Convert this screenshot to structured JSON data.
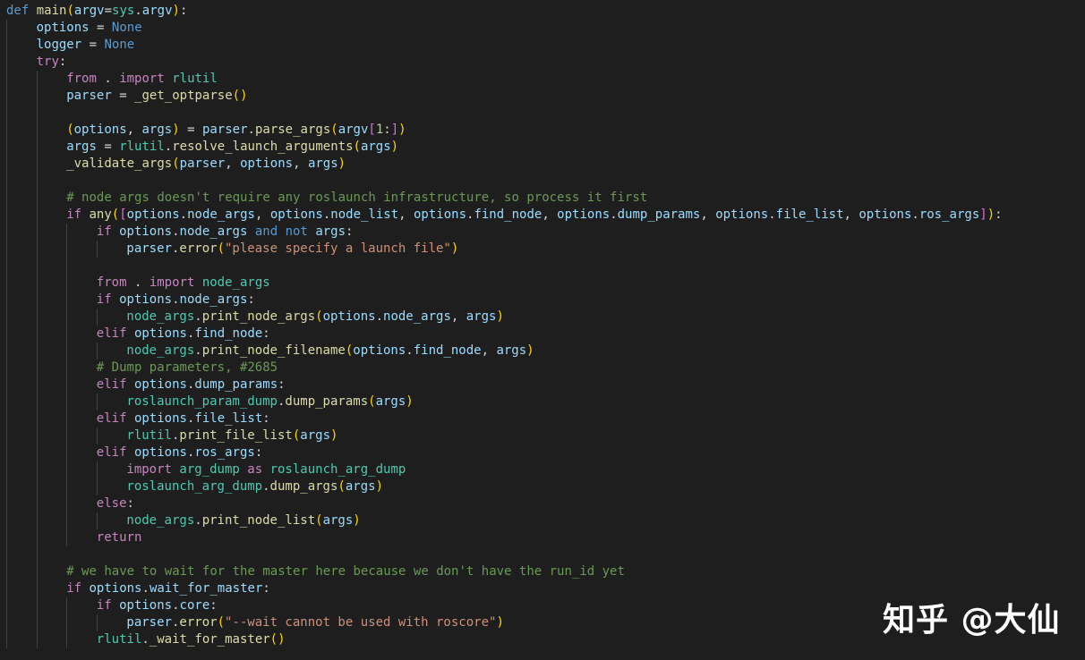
{
  "watermark": "知乎 @大仙",
  "colors": {
    "background": "#1e1e1e",
    "keyword": "#569cd6",
    "control": "#c586c0",
    "function": "#dcdcaa",
    "variable": "#9cdcfe",
    "module": "#4ec9b0",
    "string": "#ce9178",
    "number": "#b5cea8",
    "comment": "#6a9955"
  },
  "code_lines": [
    {
      "indent": 0,
      "tokens": [
        [
          "kw",
          "def"
        ],
        [
          "plain",
          " "
        ],
        [
          "fn",
          "main"
        ],
        [
          "b1",
          "("
        ],
        [
          "var",
          "argv"
        ],
        [
          "plain",
          "="
        ],
        [
          "mod",
          "sys"
        ],
        [
          "plain",
          "."
        ],
        [
          "var",
          "argv"
        ],
        [
          "b1",
          ")"
        ],
        [
          "plain",
          ":"
        ]
      ]
    },
    {
      "indent": 1,
      "tokens": [
        [
          "var",
          "options"
        ],
        [
          "plain",
          " = "
        ],
        [
          "kw",
          "None"
        ]
      ]
    },
    {
      "indent": 1,
      "tokens": [
        [
          "var",
          "logger"
        ],
        [
          "plain",
          " = "
        ],
        [
          "kw",
          "None"
        ]
      ]
    },
    {
      "indent": 1,
      "tokens": [
        [
          "ctl",
          "try"
        ],
        [
          "plain",
          ":"
        ]
      ]
    },
    {
      "indent": 2,
      "tokens": [
        [
          "ctl",
          "from"
        ],
        [
          "plain",
          " . "
        ],
        [
          "ctl",
          "import"
        ],
        [
          "plain",
          " "
        ],
        [
          "mod",
          "rlutil"
        ]
      ]
    },
    {
      "indent": 2,
      "tokens": [
        [
          "var",
          "parser"
        ],
        [
          "plain",
          " = "
        ],
        [
          "fn",
          "_get_optparse"
        ],
        [
          "b1",
          "()"
        ]
      ]
    },
    {
      "indent": 2,
      "tokens": []
    },
    {
      "indent": 2,
      "tokens": [
        [
          "b1",
          "("
        ],
        [
          "var",
          "options"
        ],
        [
          "plain",
          ", "
        ],
        [
          "var",
          "args"
        ],
        [
          "b1",
          ")"
        ],
        [
          "plain",
          " = "
        ],
        [
          "var",
          "parser"
        ],
        [
          "plain",
          "."
        ],
        [
          "fn",
          "parse_args"
        ],
        [
          "b1",
          "("
        ],
        [
          "var",
          "argv"
        ],
        [
          "b2",
          "["
        ],
        [
          "num",
          "1"
        ],
        [
          "plain",
          ":"
        ],
        [
          "b2",
          "]"
        ],
        [
          "b1",
          ")"
        ]
      ]
    },
    {
      "indent": 2,
      "tokens": [
        [
          "var",
          "args"
        ],
        [
          "plain",
          " = "
        ],
        [
          "mod",
          "rlutil"
        ],
        [
          "plain",
          "."
        ],
        [
          "fn",
          "resolve_launch_arguments"
        ],
        [
          "b1",
          "("
        ],
        [
          "var",
          "args"
        ],
        [
          "b1",
          ")"
        ]
      ]
    },
    {
      "indent": 2,
      "tokens": [
        [
          "fn",
          "_validate_args"
        ],
        [
          "b1",
          "("
        ],
        [
          "var",
          "parser"
        ],
        [
          "plain",
          ", "
        ],
        [
          "var",
          "options"
        ],
        [
          "plain",
          ", "
        ],
        [
          "var",
          "args"
        ],
        [
          "b1",
          ")"
        ]
      ]
    },
    {
      "indent": 2,
      "tokens": []
    },
    {
      "indent": 2,
      "tokens": [
        [
          "cmt",
          "# node args doesn't require any roslaunch infrastructure, so process it first"
        ]
      ]
    },
    {
      "indent": 2,
      "tokens": [
        [
          "ctl",
          "if"
        ],
        [
          "plain",
          " "
        ],
        [
          "fn",
          "any"
        ],
        [
          "b1",
          "("
        ],
        [
          "b2",
          "["
        ],
        [
          "var",
          "options"
        ],
        [
          "plain",
          "."
        ],
        [
          "var",
          "node_args"
        ],
        [
          "plain",
          ", "
        ],
        [
          "var",
          "options"
        ],
        [
          "plain",
          "."
        ],
        [
          "var",
          "node_list"
        ],
        [
          "plain",
          ", "
        ],
        [
          "var",
          "options"
        ],
        [
          "plain",
          "."
        ],
        [
          "var",
          "find_node"
        ],
        [
          "plain",
          ", "
        ],
        [
          "var",
          "options"
        ],
        [
          "plain",
          "."
        ],
        [
          "var",
          "dump_params"
        ],
        [
          "plain",
          ", "
        ],
        [
          "var",
          "options"
        ],
        [
          "plain",
          "."
        ],
        [
          "var",
          "file_list"
        ],
        [
          "plain",
          ", "
        ],
        [
          "var",
          "options"
        ],
        [
          "plain",
          "."
        ],
        [
          "var",
          "ros_args"
        ],
        [
          "b2",
          "]"
        ],
        [
          "b1",
          ")"
        ],
        [
          "plain",
          ":"
        ]
      ]
    },
    {
      "indent": 3,
      "tokens": [
        [
          "ctl",
          "if"
        ],
        [
          "plain",
          " "
        ],
        [
          "var",
          "options"
        ],
        [
          "plain",
          "."
        ],
        [
          "var",
          "node_args"
        ],
        [
          "plain",
          " "
        ],
        [
          "kw",
          "and"
        ],
        [
          "plain",
          " "
        ],
        [
          "kw",
          "not"
        ],
        [
          "plain",
          " "
        ],
        [
          "var",
          "args"
        ],
        [
          "plain",
          ":"
        ]
      ]
    },
    {
      "indent": 4,
      "tokens": [
        [
          "var",
          "parser"
        ],
        [
          "plain",
          "."
        ],
        [
          "fn",
          "error"
        ],
        [
          "b1",
          "("
        ],
        [
          "str",
          "\"please specify a launch file\""
        ],
        [
          "b1",
          ")"
        ]
      ]
    },
    {
      "indent": 3,
      "tokens": []
    },
    {
      "indent": 3,
      "tokens": [
        [
          "ctl",
          "from"
        ],
        [
          "plain",
          " . "
        ],
        [
          "ctl",
          "import"
        ],
        [
          "plain",
          " "
        ],
        [
          "mod",
          "node_args"
        ]
      ]
    },
    {
      "indent": 3,
      "tokens": [
        [
          "ctl",
          "if"
        ],
        [
          "plain",
          " "
        ],
        [
          "var",
          "options"
        ],
        [
          "plain",
          "."
        ],
        [
          "var",
          "node_args"
        ],
        [
          "plain",
          ":"
        ]
      ]
    },
    {
      "indent": 4,
      "tokens": [
        [
          "mod",
          "node_args"
        ],
        [
          "plain",
          "."
        ],
        [
          "fn",
          "print_node_args"
        ],
        [
          "b1",
          "("
        ],
        [
          "var",
          "options"
        ],
        [
          "plain",
          "."
        ],
        [
          "var",
          "node_args"
        ],
        [
          "plain",
          ", "
        ],
        [
          "var",
          "args"
        ],
        [
          "b1",
          ")"
        ]
      ]
    },
    {
      "indent": 3,
      "tokens": [
        [
          "ctl",
          "elif"
        ],
        [
          "plain",
          " "
        ],
        [
          "var",
          "options"
        ],
        [
          "plain",
          "."
        ],
        [
          "var",
          "find_node"
        ],
        [
          "plain",
          ":"
        ]
      ]
    },
    {
      "indent": 4,
      "tokens": [
        [
          "mod",
          "node_args"
        ],
        [
          "plain",
          "."
        ],
        [
          "fn",
          "print_node_filename"
        ],
        [
          "b1",
          "("
        ],
        [
          "var",
          "options"
        ],
        [
          "plain",
          "."
        ],
        [
          "var",
          "find_node"
        ],
        [
          "plain",
          ", "
        ],
        [
          "var",
          "args"
        ],
        [
          "b1",
          ")"
        ]
      ]
    },
    {
      "indent": 3,
      "tokens": [
        [
          "cmt",
          "# Dump parameters, #2685"
        ]
      ]
    },
    {
      "indent": 3,
      "tokens": [
        [
          "ctl",
          "elif"
        ],
        [
          "plain",
          " "
        ],
        [
          "var",
          "options"
        ],
        [
          "plain",
          "."
        ],
        [
          "var",
          "dump_params"
        ],
        [
          "plain",
          ":"
        ]
      ]
    },
    {
      "indent": 4,
      "tokens": [
        [
          "mod",
          "roslaunch_param_dump"
        ],
        [
          "plain",
          "."
        ],
        [
          "fn",
          "dump_params"
        ],
        [
          "b1",
          "("
        ],
        [
          "var",
          "args"
        ],
        [
          "b1",
          ")"
        ]
      ]
    },
    {
      "indent": 3,
      "tokens": [
        [
          "ctl",
          "elif"
        ],
        [
          "plain",
          " "
        ],
        [
          "var",
          "options"
        ],
        [
          "plain",
          "."
        ],
        [
          "var",
          "file_list"
        ],
        [
          "plain",
          ":"
        ]
      ]
    },
    {
      "indent": 4,
      "tokens": [
        [
          "mod",
          "rlutil"
        ],
        [
          "plain",
          "."
        ],
        [
          "fn",
          "print_file_list"
        ],
        [
          "b1",
          "("
        ],
        [
          "var",
          "args"
        ],
        [
          "b1",
          ")"
        ]
      ]
    },
    {
      "indent": 3,
      "tokens": [
        [
          "ctl",
          "elif"
        ],
        [
          "plain",
          " "
        ],
        [
          "var",
          "options"
        ],
        [
          "plain",
          "."
        ],
        [
          "var",
          "ros_args"
        ],
        [
          "plain",
          ":"
        ]
      ]
    },
    {
      "indent": 4,
      "tokens": [
        [
          "ctl",
          "import"
        ],
        [
          "plain",
          " "
        ],
        [
          "mod",
          "arg_dump"
        ],
        [
          "plain",
          " "
        ],
        [
          "ctl",
          "as"
        ],
        [
          "plain",
          " "
        ],
        [
          "mod",
          "roslaunch_arg_dump"
        ]
      ]
    },
    {
      "indent": 4,
      "tokens": [
        [
          "mod",
          "roslaunch_arg_dump"
        ],
        [
          "plain",
          "."
        ],
        [
          "fn",
          "dump_args"
        ],
        [
          "b1",
          "("
        ],
        [
          "var",
          "args"
        ],
        [
          "b1",
          ")"
        ]
      ]
    },
    {
      "indent": 3,
      "tokens": [
        [
          "ctl",
          "else"
        ],
        [
          "plain",
          ":"
        ]
      ]
    },
    {
      "indent": 4,
      "tokens": [
        [
          "mod",
          "node_args"
        ],
        [
          "plain",
          "."
        ],
        [
          "fn",
          "print_node_list"
        ],
        [
          "b1",
          "("
        ],
        [
          "var",
          "args"
        ],
        [
          "b1",
          ")"
        ]
      ]
    },
    {
      "indent": 3,
      "tokens": [
        [
          "ctl",
          "return"
        ]
      ]
    },
    {
      "indent": 2,
      "tokens": []
    },
    {
      "indent": 2,
      "tokens": [
        [
          "cmt",
          "# we have to wait for the master here because we don't have the run_id yet"
        ]
      ]
    },
    {
      "indent": 2,
      "tokens": [
        [
          "ctl",
          "if"
        ],
        [
          "plain",
          " "
        ],
        [
          "var",
          "options"
        ],
        [
          "plain",
          "."
        ],
        [
          "var",
          "wait_for_master"
        ],
        [
          "plain",
          ":"
        ]
      ]
    },
    {
      "indent": 3,
      "tokens": [
        [
          "ctl",
          "if"
        ],
        [
          "plain",
          " "
        ],
        [
          "var",
          "options"
        ],
        [
          "plain",
          "."
        ],
        [
          "var",
          "core"
        ],
        [
          "plain",
          ":"
        ]
      ]
    },
    {
      "indent": 4,
      "tokens": [
        [
          "var",
          "parser"
        ],
        [
          "plain",
          "."
        ],
        [
          "fn",
          "error"
        ],
        [
          "b1",
          "("
        ],
        [
          "str",
          "\"--wait cannot be used with roscore\""
        ],
        [
          "b1",
          ")"
        ]
      ]
    },
    {
      "indent": 3,
      "tokens": [
        [
          "mod",
          "rlutil"
        ],
        [
          "plain",
          "."
        ],
        [
          "fn",
          "_wait_for_master"
        ],
        [
          "b1",
          "()"
        ]
      ]
    }
  ]
}
